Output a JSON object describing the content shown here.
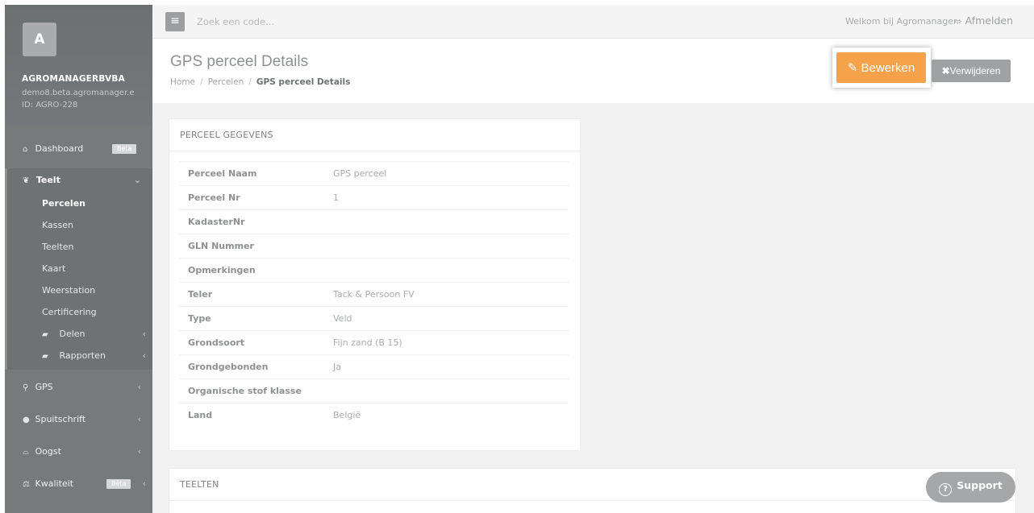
{
  "sidebar": {
    "avatar_letter": "A",
    "company_name": "AGROMANAGERBVBA",
    "company_domain": "demo8.beta.agromanager.e",
    "company_id": "ID: AGRO-228",
    "dashboard": {
      "label": "Dashboard",
      "badge": "Beta",
      "icon": "home-icon"
    },
    "teelt": {
      "label": "Teelt",
      "icon": "leaf-icon",
      "chevron": "⌄",
      "items": [
        {
          "label": "Percelen",
          "active": true
        },
        {
          "label": "Kassen"
        },
        {
          "label": "Teelten"
        },
        {
          "label": "Kaart"
        },
        {
          "label": "Weerstation"
        },
        {
          "label": "Certificering"
        },
        {
          "label": "Delen",
          "icon": "folder-open-icon",
          "chevron": "‹"
        },
        {
          "label": "Rapporten",
          "icon": "folder-open-icon",
          "chevron": "‹"
        }
      ]
    },
    "lower": [
      {
        "label": "GPS",
        "icon": "map-marker-icon",
        "chevron": "‹"
      },
      {
        "label": "Spuitschrift",
        "icon": "tint-icon",
        "chevron": "‹"
      },
      {
        "label": "Oogst",
        "icon": "basket-icon",
        "chevron": "‹"
      },
      {
        "label": "Kwaliteit",
        "icon": "balance-scale-icon",
        "badge": "Bèta",
        "chevron": "‹"
      }
    ]
  },
  "topbar": {
    "search_placeholder": "Zoek een code...",
    "welcome": "Welkom bij Agromanager.",
    "logout": "Afmelden"
  },
  "header": {
    "title": "GPS perceel Details",
    "breadcrumb": [
      "Home",
      "Percelen",
      "GPS perceel Details"
    ],
    "edit_label": "Bewerken",
    "delete_label": "Verwijderen"
  },
  "card_perceel": {
    "title": "PERCEEL GEGEVENS",
    "rows": [
      {
        "label": "Perceel Naam",
        "value": "GPS perceel"
      },
      {
        "label": "Perceel Nr",
        "value": "1"
      },
      {
        "label": "KadasterNr",
        "value": ""
      },
      {
        "label": "GLN Nummer",
        "value": ""
      },
      {
        "label": "Opmerkingen",
        "value": ""
      },
      {
        "label": "Teler",
        "value": "Tack & Persoon FV"
      },
      {
        "label": "Type",
        "value": "Veld"
      },
      {
        "label": "Grondsoort",
        "value": "Fijn zand (B 15)"
      },
      {
        "label": "Grondgebonden",
        "value": "Ja"
      },
      {
        "label": "Organische stof klasse",
        "value": ""
      },
      {
        "label": "Land",
        "value": "België"
      }
    ]
  },
  "card_teelten": {
    "title": "TEELTEN"
  },
  "support": {
    "label": "Support"
  },
  "colors": {
    "accent_orange": "#f5a24a",
    "sidebar_bg": "#777a7b",
    "content_bg": "#f1f1f1"
  }
}
